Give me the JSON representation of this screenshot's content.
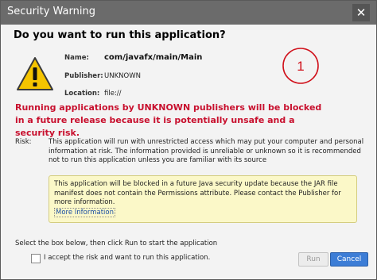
{
  "window": {
    "title": "Security Warning",
    "close_glyph": "✕"
  },
  "heading": "Do you want to run this application?",
  "app_info": {
    "name_label": "Name:",
    "name_value": "com/javafx/main/Main",
    "publisher_label": "Publisher:",
    "publisher_value": "UNKNOWN",
    "location_label": "Location:",
    "location_value": "file://"
  },
  "annotation_number": "1",
  "warning_message": "Running applications by UNKNOWN publishers will be blocked in a future release because it is potentially unsafe and a security risk.",
  "risk": {
    "label": "Risk:",
    "text": "This application will run with unrestricted access which may put your computer and personal information at risk. The information provided is unreliable or unknown so it is recommended not to run this application unless you are familiar with its source"
  },
  "notice": {
    "text": "This application will be blocked in a future Java security update because the JAR file manifest does not contain the Permissions attribute. Please contact the Publisher for more information.",
    "link_label": "More Information"
  },
  "select_hint": "Select the box below, then click Run to start the application",
  "accept_checkbox": {
    "label": "I accept the risk and want to run this application.",
    "checked": false
  },
  "buttons": {
    "run": "Run",
    "cancel": "Cancel"
  },
  "colors": {
    "title_bar": "#6b6b6b",
    "warning_text": "#c8102e",
    "notice_bg": "#fbf8c8",
    "primary_button": "#3c7dd6",
    "annotation": "#d0101a"
  }
}
